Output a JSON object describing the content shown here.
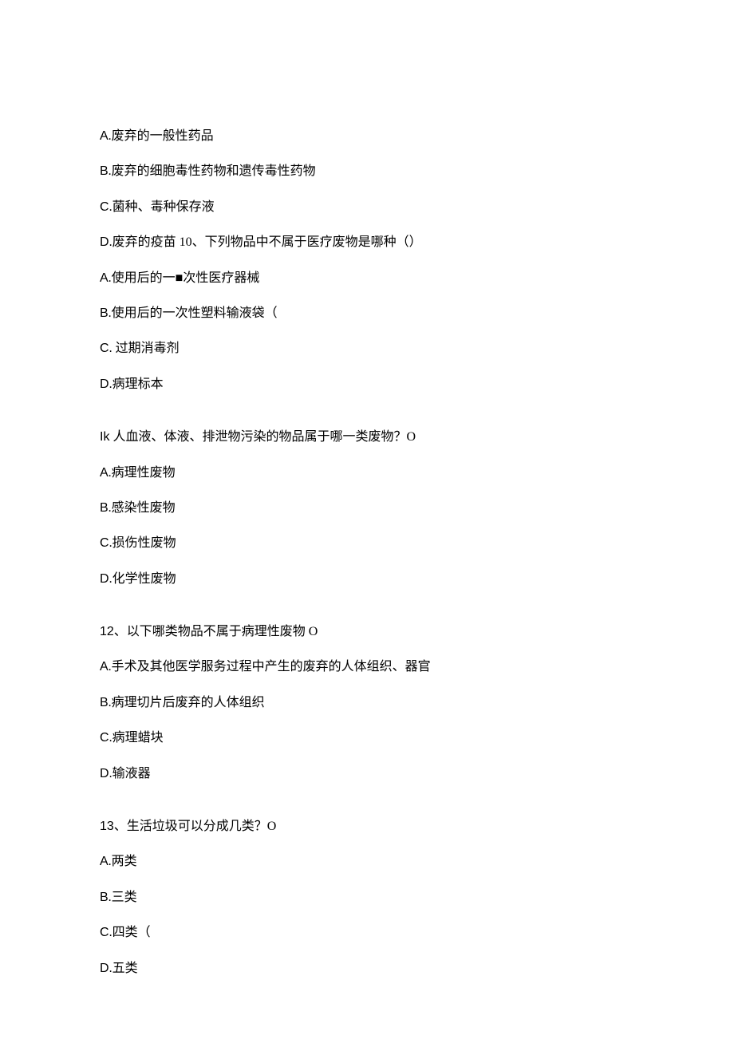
{
  "lines": [
    {
      "text": "A.废弃的一般性药品",
      "gap": false
    },
    {
      "text": "B.废弃的细胞毒性药物和遗传毒性药物",
      "gap": false
    },
    {
      "text": "C.菌种、毒种保存液",
      "gap": false
    },
    {
      "text": "D.废弃的疫苗 10、下列物品中不属于医疗废物是哪种（）",
      "gap": false
    },
    {
      "text": "A.使用后的一■次性医疗器械",
      "gap": false
    },
    {
      "text": "B.使用后的一次性塑料输液袋（",
      "gap": false
    },
    {
      "text": "C. 过期消毒剂",
      "gap": false
    },
    {
      "text": "D.病理标本",
      "gap": false
    },
    {
      "text": "Ik 人血液、体液、排泄物污染的物品属于哪一类废物？O",
      "gap": true
    },
    {
      "text": "A.病理性废物",
      "gap": false
    },
    {
      "text": "B.感染性废物",
      "gap": false
    },
    {
      "text": "C.损伤性废物",
      "gap": false
    },
    {
      "text": "D.化学性废物",
      "gap": false
    },
    {
      "text": "12、以下哪类物品不属于病理性废物 O",
      "gap": true
    },
    {
      "text": "A.手术及其他医学服务过程中产生的废弃的人体组织、器官",
      "gap": false
    },
    {
      "text": "B.病理切片后废弃的人体组织",
      "gap": false
    },
    {
      "text": "C.病理蜡块",
      "gap": false
    },
    {
      "text": "D.输液器",
      "gap": false
    },
    {
      "text": "13、生活垃圾可以分成几类？O",
      "gap": true
    },
    {
      "text": "A.两类",
      "gap": false
    },
    {
      "text": "B.三类",
      "gap": false
    },
    {
      "text": "C.四类（",
      "gap": false
    },
    {
      "text": "D.五类",
      "gap": false
    }
  ]
}
